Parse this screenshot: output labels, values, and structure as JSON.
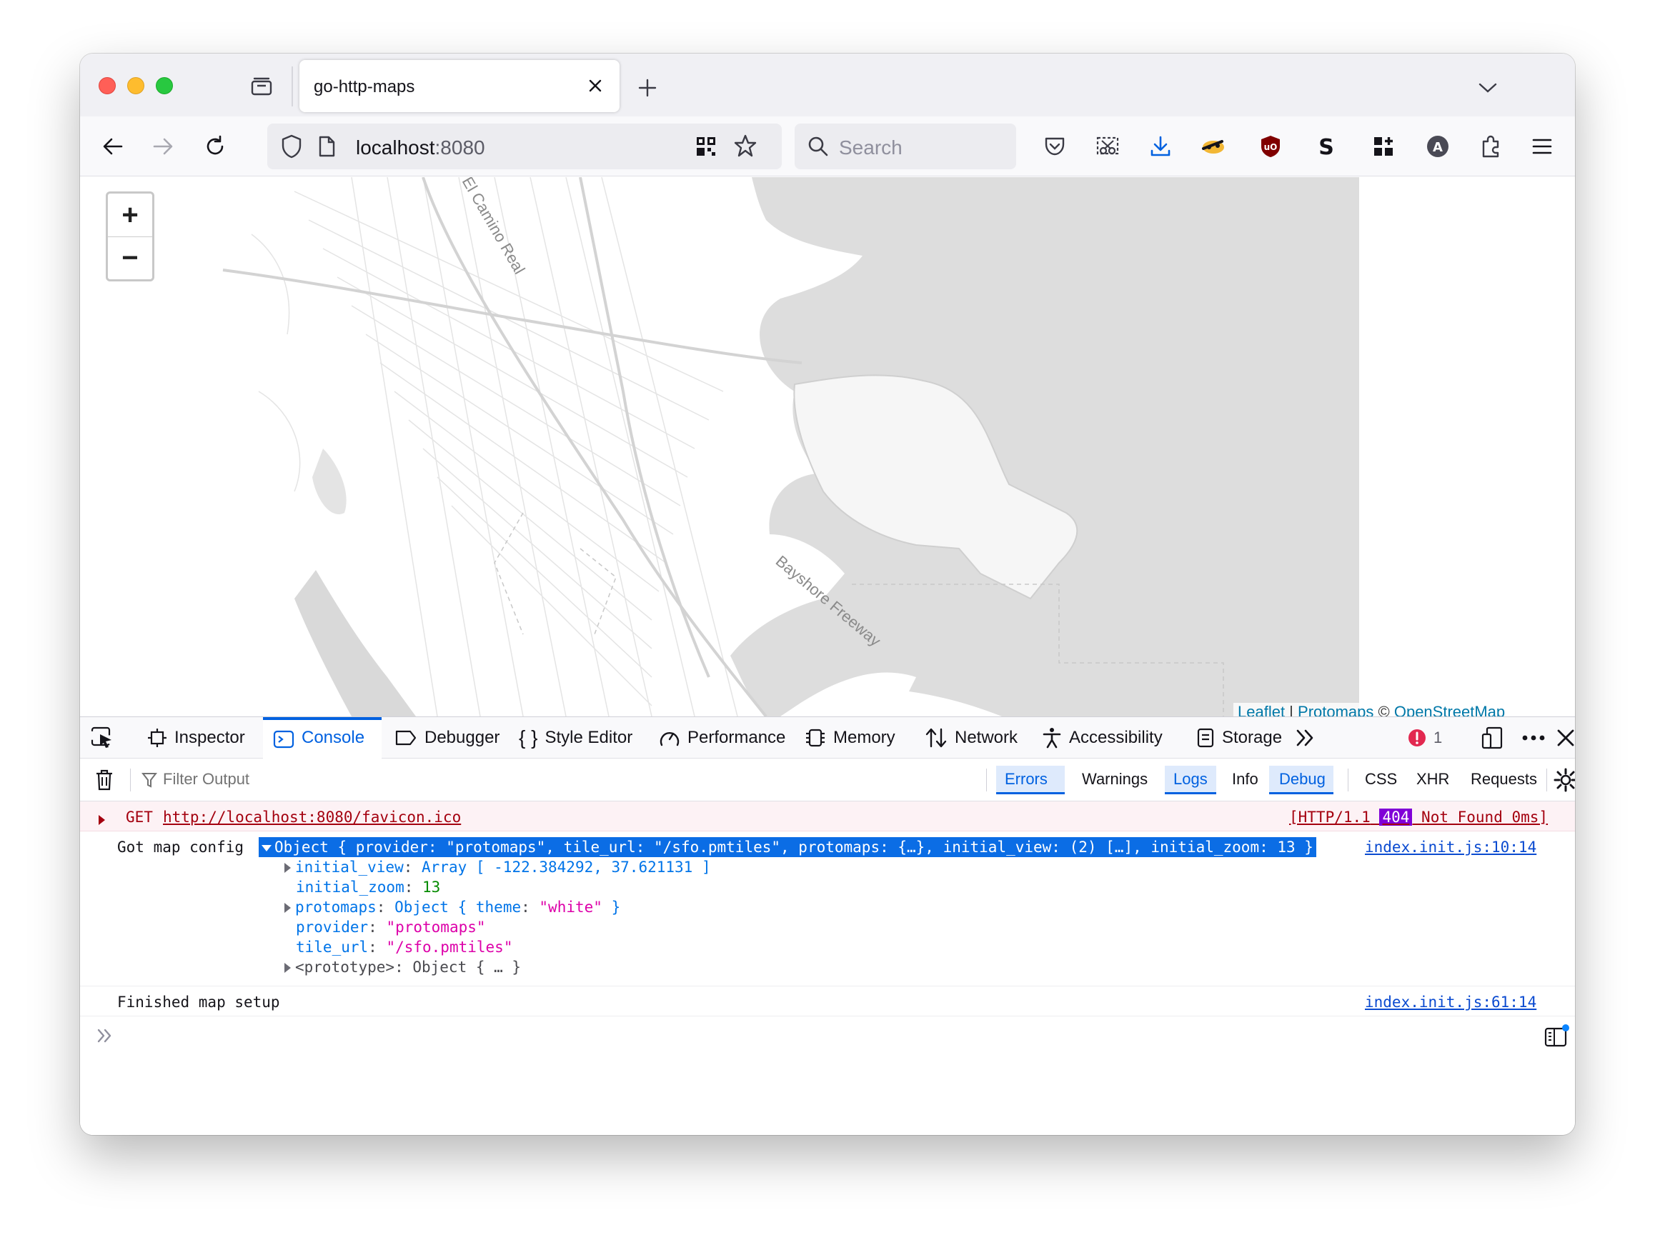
{
  "browser": {
    "tab_title": "go-http-maps",
    "url_host": "localhost",
    "url_port": ":8080",
    "search_placeholder": "Search"
  },
  "map": {
    "labels": [
      "El Camino Real",
      "Bayshore Freeway"
    ],
    "zoom_in": "+",
    "zoom_out": "−",
    "attribution": {
      "leaflet": "Leaflet",
      "sep": " | ",
      "protomaps": "Protomaps",
      "osm_prefix": " © ",
      "osm": "OpenStreetMap"
    }
  },
  "devtools": {
    "tabs": [
      {
        "label": "Inspector",
        "icon": "inspector-icon"
      },
      {
        "label": "Console",
        "icon": "console-icon"
      },
      {
        "label": "Debugger",
        "icon": "debugger-icon"
      },
      {
        "label": "Style Editor",
        "icon": "style-editor-icon"
      },
      {
        "label": "Performance",
        "icon": "performance-icon"
      },
      {
        "label": "Memory",
        "icon": "memory-icon"
      },
      {
        "label": "Network",
        "icon": "network-icon"
      },
      {
        "label": "Accessibility",
        "icon": "accessibility-icon"
      },
      {
        "label": "Storage",
        "icon": "storage-icon"
      }
    ],
    "active_tab": "Console",
    "error_count": "1",
    "filter_placeholder": "Filter Output",
    "filters": [
      "Errors",
      "Warnings",
      "Logs",
      "Info",
      "Debug"
    ],
    "filters_active": [
      "Errors",
      "Logs",
      "Debug"
    ],
    "extra_filters": [
      "CSS",
      "XHR",
      "Requests"
    ],
    "messages": {
      "error": {
        "method": "GET",
        "url": "http://localhost:8080/favicon.ico",
        "status_prefix": "[HTTP/1.1",
        "status_code": "404",
        "status_suffix": "Not Found 0ms]"
      },
      "log1": {
        "prefix": "Got map config",
        "summary": "Object { provider: \"protomaps\", tile_url: \"/sfo.pmtiles\", protomaps: {…}, initial_view: (2) […], initial_zoom: 13 }",
        "source": "index.init.js:10:14",
        "props": {
          "initial_view_key": "initial_view",
          "initial_view_val": "Array [ -122.384292, 37.621131 ]",
          "initial_zoom_key": "initial_zoom",
          "initial_zoom_val": "13",
          "protomaps_key": "protomaps",
          "protomaps_type": "Object { ",
          "protomaps_inner_key": "theme",
          "protomaps_inner_val": "\"white\"",
          "protomaps_close": " }",
          "provider_key": "provider",
          "provider_val": "\"protomaps\"",
          "tile_url_key": "tile_url",
          "tile_url_val": "\"/sfo.pmtiles\"",
          "prototype": "<prototype>: Object { … }"
        }
      },
      "log2": {
        "text": "Finished map setup",
        "source": "index.init.js:61:14"
      }
    }
  }
}
